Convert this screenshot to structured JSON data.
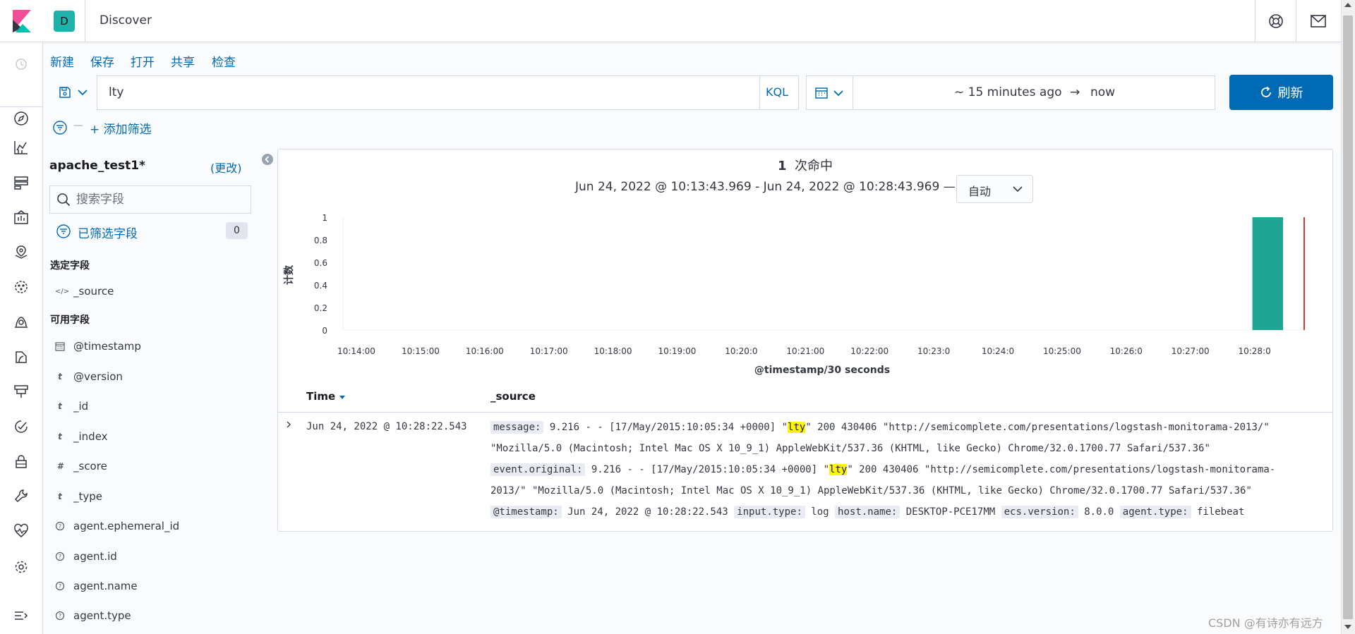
{
  "header": {
    "app_badge": "D",
    "title": "Discover"
  },
  "menu": {
    "new": "新建",
    "save": "保存",
    "open": "打开",
    "share": "共享",
    "inspect": "检查"
  },
  "query": {
    "text": "lty",
    "language": "KQL"
  },
  "time": {
    "start": "~ 15 minutes ago",
    "arrow": "→",
    "end": "now",
    "refresh_label": "刷新"
  },
  "filters": {
    "dash": "—",
    "add_label": "+ 添加筛选"
  },
  "sidebar": {
    "index_pattern": "apache_test1*",
    "change_label": "(更改)",
    "search_placeholder": "搜索字段",
    "filtered_label": "已筛选字段",
    "filtered_count": "0",
    "selected_title": "选定字段",
    "selected_fields": [
      {
        "type": "</>",
        "name": "_source"
      }
    ],
    "available_title": "可用字段",
    "available_fields": [
      {
        "type": "date",
        "name": "@timestamp"
      },
      {
        "type": "t",
        "name": "@version"
      },
      {
        "type": "t",
        "name": "_id"
      },
      {
        "type": "t",
        "name": "_index"
      },
      {
        "type": "#",
        "name": "_score"
      },
      {
        "type": "t",
        "name": "_type"
      },
      {
        "type": "?",
        "name": "agent.ephemeral_id"
      },
      {
        "type": "?",
        "name": "agent.id"
      },
      {
        "type": "?",
        "name": "agent.name"
      },
      {
        "type": "?",
        "name": "agent.type"
      }
    ]
  },
  "results": {
    "hit_count": "1",
    "hit_label": "次命中",
    "range_text": "Jun 24, 2022 @ 10:13:43.969 - Jun 24, 2022 @ 10:28:43.969 —",
    "interval": "自动"
  },
  "chart_data": {
    "type": "bar",
    "ylabel": "计数",
    "xlabel": "@timestamp/30 seconds",
    "y_ticks": [
      "0",
      "0.2",
      "0.4",
      "0.6",
      "0.8",
      "1"
    ],
    "ylim": [
      0,
      1
    ],
    "x_ticks": [
      "10:14:00",
      "10:15:00",
      "10:16:00",
      "10:17:00",
      "10:18:00",
      "10:19:00",
      "10:20:0",
      "10:21:00",
      "10:22:00",
      "10:23:0",
      "10:24:0",
      "10:25:00",
      "10:26:0",
      "10:27:00",
      "10:28:0"
    ],
    "bars": [
      {
        "x": "10:28:00",
        "value": 1
      }
    ],
    "bar_color": "#20a595",
    "now_line_color": "#d23a3a"
  },
  "table": {
    "col_time": "Time",
    "col_source": "_source",
    "rows": [
      {
        "time": "Jun 24, 2022 @ 10:28:22.543",
        "line1_key": "message:",
        "line1_pre": " 9.216 - - [17/May/2015:10:05:34 +0000] \"",
        "line1_hl": "lty",
        "line1_post": "\" 200 430406 \"http://semicomplete.com/presentations/logstash-monitorama-2013/\"",
        "line2": "\"Mozilla/5.0 (Macintosh; Intel Mac OS X 10_9_1) AppleWebKit/537.36 (KHTML, like Gecko) Chrome/32.0.1700.77 Safari/537.36\"",
        "line3_key": "event.original:",
        "line3_pre": " 9.216 - - [17/May/2015:10:05:34 +0000] \"",
        "line3_hl": "lty",
        "line3_post": "\" 200 430406 \"http://semicomplete.com/presentations/logstash-monitorama-",
        "line4": "2013/\" \"Mozilla/5.0 (Macintosh; Intel Mac OS X 10_9_1) AppleWebKit/537.36 (KHTML, like Gecko) Chrome/32.0.1700.77 Safari/537.36\"",
        "kv": [
          {
            "key": "@timestamp:",
            "val": " Jun 24, 2022 @ 10:28:22.543 "
          },
          {
            "key": "input.type:",
            "val": " log "
          },
          {
            "key": "host.name:",
            "val": " DESKTOP-PCE17MM "
          },
          {
            "key": "ecs.version:",
            "val": " 8.0.0 "
          },
          {
            "key": "agent.type:",
            "val": " filebeat"
          }
        ]
      }
    ]
  },
  "watermark": "CSDN @有诗亦有远方"
}
